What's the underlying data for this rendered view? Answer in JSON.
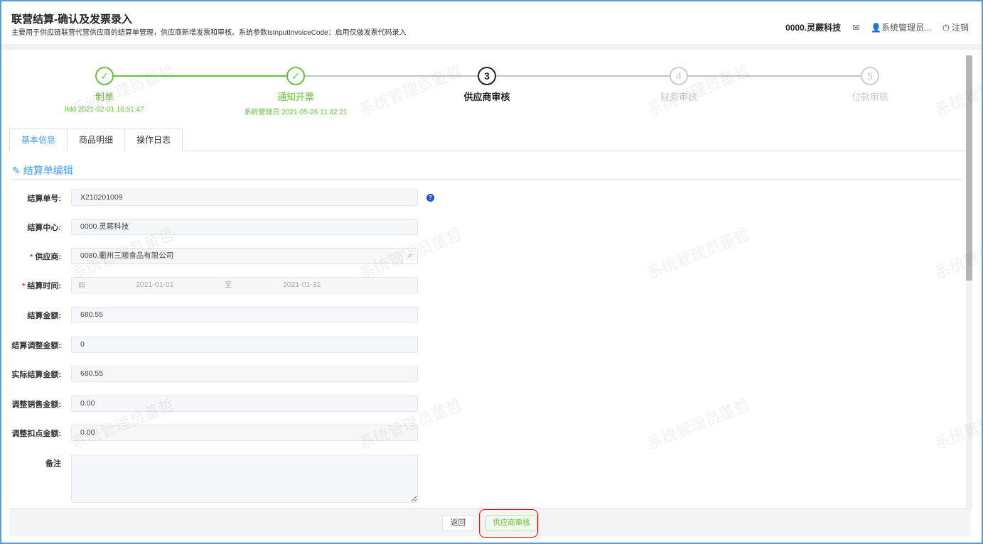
{
  "header": {
    "title": "联营结算-确认及发票录入",
    "subtitle": "主要用于供应链联营代营供应商的结算单管理，供应商新增发票和审核。系统参数IsInputInvoiceCode：启用仅做发票代码录入",
    "org": "0000.灵蕨科技",
    "user": "系统管理员...",
    "logout": "注销"
  },
  "steps": [
    {
      "num": "1",
      "label": "制单",
      "desc": "lldd 2021-02-01 16:51:47",
      "status": "done"
    },
    {
      "num": "2",
      "label": "通知开票",
      "desc": "系统管理员 2021-05-26 11:42:21",
      "status": "done"
    },
    {
      "num": "3",
      "label": "供应商审核",
      "desc": "",
      "status": "current"
    },
    {
      "num": "4",
      "label": "财务审核",
      "desc": "",
      "status": "pending"
    },
    {
      "num": "5",
      "label": "付款审核",
      "desc": "",
      "status": "pending"
    }
  ],
  "tabs": [
    "基本信息",
    "商品明细",
    "操作日志"
  ],
  "section_title": "结算单编辑",
  "form": {
    "settle_no": {
      "label": "结算单号:",
      "value": "X210201009"
    },
    "center": {
      "label": "结算中心:",
      "value": "0000.灵蕨科技"
    },
    "supplier": {
      "label": "供应商:",
      "value": "0080.衢州三顺食品有限公司"
    },
    "period": {
      "label": "结算时间:",
      "start": "2021-01-01",
      "sep": "至",
      "end": "2021-01-31"
    },
    "amount": {
      "label": "结算金额:",
      "value": "680.55"
    },
    "adjust": {
      "label": "结算调整金额:",
      "value": "0"
    },
    "actual": {
      "label": "实际结算金额:",
      "value": "680.55"
    },
    "adj_sales": {
      "label": "调整销售金额:",
      "value": "0.00"
    },
    "adj_point": {
      "label": "调整扣点金额:",
      "value": "0.00"
    },
    "remark": {
      "label": "备注",
      "value": ""
    }
  },
  "buttons": {
    "back": "返回",
    "audit": "供应商审核"
  },
  "watermark": "系统管理员董哲"
}
